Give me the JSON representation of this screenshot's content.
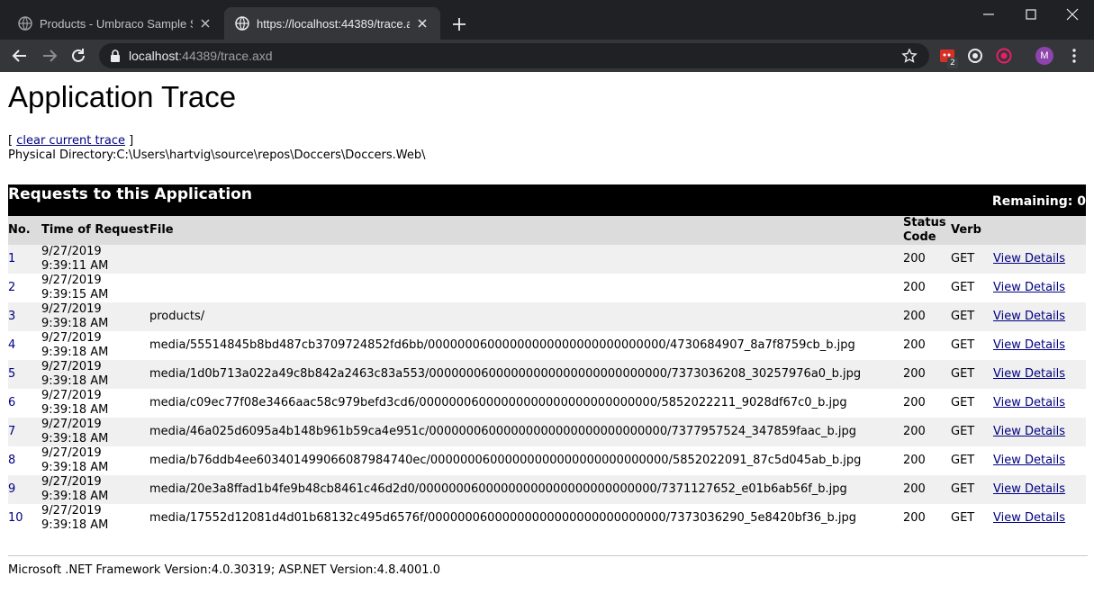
{
  "browser": {
    "tabs": [
      {
        "title": "Products - Umbraco Sample Site",
        "active": false,
        "favicon": "globe-icon"
      },
      {
        "title": "https://localhost:44389/trace.axd",
        "active": true,
        "favicon": "globe-icon"
      }
    ],
    "url_host": "localhost",
    "url_rest": ":44389/trace.axd",
    "extension_badge": "2",
    "avatar_letter": "M"
  },
  "page": {
    "title": "Application Trace",
    "clear_open": "[ ",
    "clear_link": "clear current trace",
    "clear_close": " ]",
    "physical_directory_label": "Physical Directory:",
    "physical_directory": "C:\\Users\\hartvig\\source\\repos\\Doccers\\Doccers.Web\\",
    "table_title": "Requests to this Application",
    "remaining_label": "Remaining: 0",
    "columns": {
      "no": "No.",
      "time": "Time of Request",
      "file": "File",
      "status": "Status Code",
      "verb": "Verb"
    },
    "rows": [
      {
        "no": "1",
        "date": "9/27/2019",
        "time": "9:39:11 AM",
        "file": "",
        "status": "200",
        "verb": "GET",
        "details": "View Details"
      },
      {
        "no": "2",
        "date": "9/27/2019",
        "time": "9:39:15 AM",
        "file": "",
        "status": "200",
        "verb": "GET",
        "details": "View Details"
      },
      {
        "no": "3",
        "date": "9/27/2019",
        "time": "9:39:18 AM",
        "file": "products/",
        "status": "200",
        "verb": "GET",
        "details": "View Details"
      },
      {
        "no": "4",
        "date": "9/27/2019",
        "time": "9:39:18 AM",
        "file": "media/55514845b8bd487cb3709724852fd6bb/00000006000000000000000000000000/4730684907_8a7f8759cb_b.jpg",
        "status": "200",
        "verb": "GET",
        "details": "View Details"
      },
      {
        "no": "5",
        "date": "9/27/2019",
        "time": "9:39:18 AM",
        "file": "media/1d0b713a022a49c8b842a2463c83a553/00000006000000000000000000000000/7373036208_30257976a0_b.jpg",
        "status": "200",
        "verb": "GET",
        "details": "View Details"
      },
      {
        "no": "6",
        "date": "9/27/2019",
        "time": "9:39:18 AM",
        "file": "media/c09ec77f08e3466aac58c979befd3cd6/00000006000000000000000000000000/5852022211_9028df67c0_b.jpg",
        "status": "200",
        "verb": "GET",
        "details": "View Details"
      },
      {
        "no": "7",
        "date": "9/27/2019",
        "time": "9:39:18 AM",
        "file": "media/46a025d6095a4b148b961b59ca4e951c/00000006000000000000000000000000/7377957524_347859faac_b.jpg",
        "status": "200",
        "verb": "GET",
        "details": "View Details"
      },
      {
        "no": "8",
        "date": "9/27/2019",
        "time": "9:39:18 AM",
        "file": "media/b76ddb4ee6034014990660879847 40ec/00000006000000000000000000000000/5852022091_87c5d045ab_b.jpg",
        "status": "200",
        "verb": "GET",
        "details": "View Details"
      },
      {
        "no": "9",
        "date": "9/27/2019",
        "time": "9:39:18 AM",
        "file": "media/20e3a8ffad1b4fe9b48cb8461c46d2d0/00000006000000000000000000000000/7371127652_e01b6ab56f_b.jpg",
        "status": "200",
        "verb": "GET",
        "details": "View Details"
      },
      {
        "no": "10",
        "date": "9/27/2019",
        "time": "9:39:18 AM",
        "file": "media/17552d12081d4d01b68132c495d6576f/00000006000000000000000000000000/7373036290_5e8420bf36_b.jpg",
        "status": "200",
        "verb": "GET",
        "details": "View Details"
      }
    ],
    "footer": "Microsoft .NET Framework Version:4.0.30319; ASP.NET Version:4.8.4001.0"
  }
}
